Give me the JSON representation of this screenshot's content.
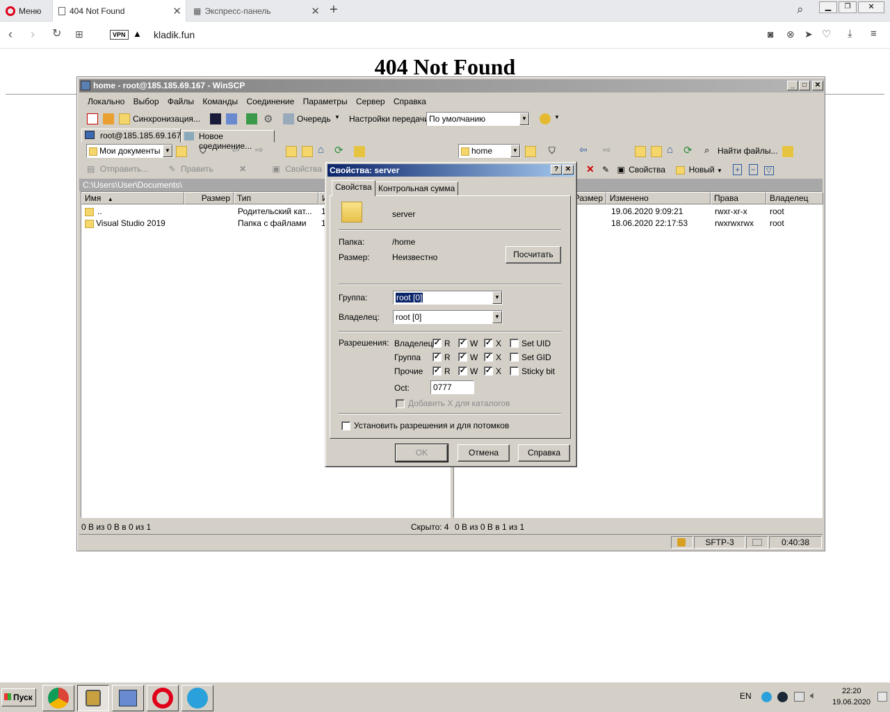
{
  "browser": {
    "menu_label": "Меню",
    "tabs": [
      {
        "label": "404 Not Found",
        "active": true
      },
      {
        "label": "Экспресс-панель",
        "active": false
      }
    ],
    "vpn_badge": "VPN",
    "url": "kladik.fun"
  },
  "page": {
    "heading": "404 Not Found"
  },
  "winscp": {
    "title": "home - root@185.185.69.167 - WinSCP",
    "menu": [
      "Локально",
      "Выбор",
      "Файлы",
      "Команды",
      "Соединение",
      "Параметры",
      "Сервер",
      "Справка"
    ],
    "toolbar": {
      "sync_label": "Синхронизация...",
      "queue_label": "Очередь",
      "transfer_settings_label": "Настройки передачи",
      "transfer_preset": "По умолчанию"
    },
    "session_tabs": [
      "root@185.185.69.167",
      "Новое соединение..."
    ],
    "left_panel": {
      "location": "Мои документы",
      "path": "C:\\Users\\User\\Documents\\",
      "actions": {
        "send": "Отправить...",
        "edit": "Править",
        "properties": "Свойства"
      },
      "columns": [
        "Имя",
        "Размер",
        "Тип",
        "И"
      ],
      "rows": [
        {
          "name": "..",
          "size": "",
          "type": "Родительский кат...",
          "changed": "1"
        },
        {
          "name": "Visual Studio 2019",
          "size": "",
          "type": "Папка с файлами",
          "changed": "1"
        }
      ],
      "status": "0 B из 0 B в 0 из 1",
      "hidden": "Скрыто: 4"
    },
    "right_panel": {
      "location": "home",
      "find_files": "Найти файлы...",
      "actions": {
        "properties": "Свойства",
        "new": "Новый"
      },
      "columns": [
        "Размер",
        "Изменено",
        "Права",
        "Владелец"
      ],
      "rows": [
        {
          "size": "",
          "changed": "19.06.2020 9:09:21",
          "rights": "rwxr-xr-x",
          "owner": "root"
        },
        {
          "size": "",
          "changed": "18.06.2020 22:17:53",
          "rights": "rwxrwxrwx",
          "owner": "root"
        }
      ],
      "status": "0 B из 0 B в 1 из 1"
    },
    "statusbar": {
      "protocol": "SFTP-3",
      "time": "0:40:38"
    }
  },
  "dialog": {
    "title": "Свойства: server",
    "help_btn": "?",
    "close_btn": "✕",
    "tabs": [
      "Свойства",
      "Контрольная сумма"
    ],
    "name": "server",
    "folder_label": "Папка:",
    "folder_value": "/home",
    "size_label": "Размер:",
    "size_value": "Неизвестно",
    "calc_button": "Посчитать",
    "group_label": "Группа:",
    "group_value": "root [0]",
    "owner_label": "Владелец:",
    "owner_value": "root [0]",
    "permissions_label": "Разрешения:",
    "perm_rows": [
      {
        "label": "Владелец",
        "r": true,
        "w": true,
        "x": true,
        "extra": "Set UID",
        "extra_checked": false
      },
      {
        "label": "Группа",
        "r": true,
        "w": true,
        "x": true,
        "extra": "Set GID",
        "extra_checked": false
      },
      {
        "label": "Прочие",
        "r": true,
        "w": true,
        "x": true,
        "extra": "Sticky bit",
        "extra_checked": false
      }
    ],
    "r_label": "R",
    "w_label": "W",
    "x_label": "X",
    "octal_label": "Oct:",
    "octal_value": "0777",
    "add_x_label": "Добавить X для каталогов",
    "recursive_label": "Установить разрешения и для потомков",
    "ok_button": "OK",
    "cancel_button": "Отмена",
    "help_button": "Справка"
  },
  "taskbar": {
    "start_label": "Пуск",
    "lang": "EN",
    "clock_time": "22:20",
    "clock_date": "19.06.2020"
  }
}
